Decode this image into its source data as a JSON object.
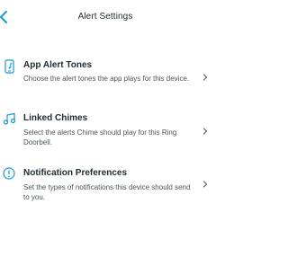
{
  "header": {
    "title": "Alert Settings",
    "back_icon": "chevron-left-icon"
  },
  "accent_color": "#1998d5",
  "rows": [
    {
      "icon": "phone-music-icon",
      "title": "App Alert Tones",
      "description": "Choose the alert tones the app plays for this device."
    },
    {
      "icon": "music-note-icon",
      "title": "Linked Chimes",
      "description": "Select the alerts Chime should play for this Ring Doorbell."
    },
    {
      "icon": "info-circle-icon",
      "title": "Notification Preferences",
      "description": "Set the types of notifications this device should send to you."
    }
  ]
}
